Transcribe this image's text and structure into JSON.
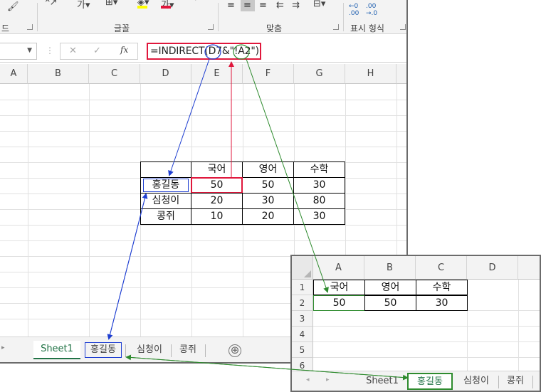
{
  "ribbon": {
    "font_group": "글꼴",
    "align_group": "맞춤",
    "number_group": "표시 형식",
    "clipboard_group_tail": "드",
    "decimal_increase": ".00",
    "decimal_increase2": "←0",
    "decimal_decrease": ".00",
    "decimal_decrease2": "→.0"
  },
  "formula_bar": {
    "cancel": "✕",
    "enter": "✓",
    "fx": "fx",
    "formula": "=INDIRECT(D7&\"!A2\")"
  },
  "main_sheet": {
    "columns": [
      "A",
      "B",
      "C",
      "D",
      "E",
      "F",
      "G",
      "H"
    ],
    "table": {
      "headers": [
        "",
        "국어",
        "영어",
        "수학"
      ],
      "rows": [
        [
          "홍길동",
          "50",
          "50",
          "30"
        ],
        [
          "심청이",
          "20",
          "30",
          "80"
        ],
        [
          "콩쥐",
          "10",
          "20",
          "30"
        ]
      ]
    },
    "tabs": [
      "Sheet1",
      "홍길동",
      "심청이",
      "콩쥐"
    ],
    "add_sheet": "⊕"
  },
  "second_sheet": {
    "columns": [
      "A",
      "B",
      "C",
      "D"
    ],
    "rows": [
      "1",
      "2",
      "3",
      "4",
      "5",
      "6"
    ],
    "header_row": [
      "국어",
      "영어",
      "수학"
    ],
    "data_row": [
      "50",
      "50",
      "30"
    ],
    "tabs": [
      "Sheet1",
      "홍길동",
      "심청이",
      "콩쥐"
    ]
  },
  "colors": {
    "blue": "#1f3fd1",
    "red": "#e0173c",
    "green": "#2e8b2e",
    "tab_active_green": "#217346"
  }
}
